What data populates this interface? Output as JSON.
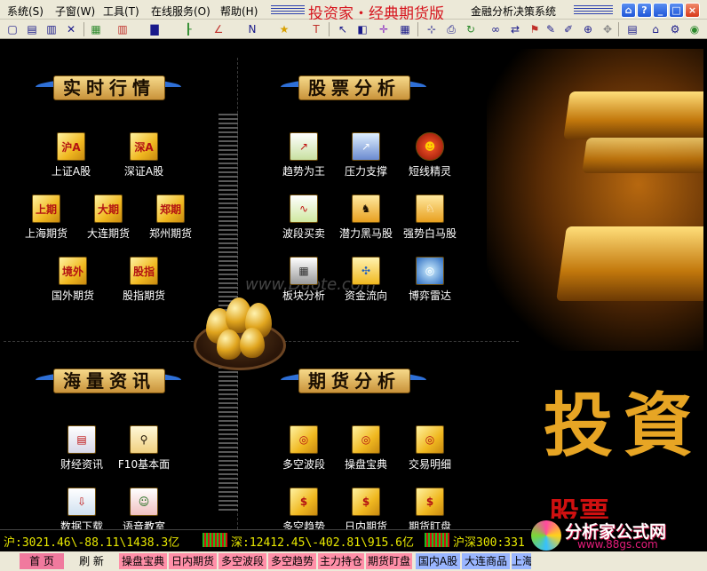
{
  "menu": {
    "system": "系统(S)",
    "subwindow": "子窗(W)",
    "tools": "工具(T)",
    "online": "在线服务(O)",
    "help": "帮助(H)"
  },
  "title": {
    "app_name": "投资家・经典期货版",
    "subtitle": "金融分析决策系统"
  },
  "sections": {
    "realtime": "实时行情",
    "stock_analysis": "股票分析",
    "news": "海量资讯",
    "futures_analysis": "期货分析"
  },
  "realtime_tiles": [
    {
      "icon": "沪A",
      "label": "上证A股"
    },
    {
      "icon": "深A",
      "label": "深证A股"
    },
    {
      "icon": "上期",
      "label": "上海期货"
    },
    {
      "icon": "大期",
      "label": "大连期货"
    },
    {
      "icon": "郑期",
      "label": "郑州期货"
    },
    {
      "icon": "境外",
      "label": "国外期货"
    },
    {
      "icon": "股指",
      "label": "股指期货"
    }
  ],
  "stock_tiles": [
    {
      "icon_name": "trend-chart-icon",
      "label": "趋势为王"
    },
    {
      "icon_name": "pressure-chart-icon",
      "label": "压力支撑"
    },
    {
      "icon_name": "devil-icon",
      "label": "短线精灵"
    },
    {
      "icon_name": "wave-chart-icon",
      "label": "波段买卖"
    },
    {
      "icon_name": "black-horse-icon",
      "label": "潜力黑马股"
    },
    {
      "icon_name": "white-horse-icon",
      "label": "强势白马股"
    },
    {
      "icon_name": "blocks-icon",
      "label": "板块分析"
    },
    {
      "icon_name": "money-flow-icon",
      "label": "资金流向"
    },
    {
      "icon_name": "radar-icon",
      "label": "博弈雷达"
    }
  ],
  "news_tiles": [
    {
      "icon_name": "finance-news-icon",
      "label": "财经资讯"
    },
    {
      "icon_name": "magnifier-icon",
      "label": "F10基本面"
    },
    {
      "icon_name": "download-icon",
      "label": "数据下载"
    },
    {
      "icon_name": "voice-class-icon",
      "label": "语音教室"
    }
  ],
  "futures_tiles": [
    {
      "icon_name": "target-icon",
      "label": "多空波段"
    },
    {
      "icon_name": "target-icon",
      "label": "操盘宝典"
    },
    {
      "icon_name": "target-icon",
      "label": "交易明细"
    },
    {
      "icon_name": "money-bag-icon",
      "label": "多空趋势"
    },
    {
      "icon_name": "money-bag-icon",
      "label": "日内期货"
    },
    {
      "icon_name": "money-bag-icon",
      "label": "期货盯盘"
    }
  ],
  "banner": {
    "big_text": "投資",
    "sub_text": "股票",
    "watermark": "www.Duote.com"
  },
  "ticker": {
    "sh": "沪:3021.46\\-88.11\\1438.3亿",
    "sz": "深:12412.45\\-402.81\\915.6亿",
    "hs300": "沪深300:331"
  },
  "logo": {
    "name": "分析家公式网",
    "url": "www.88gs.com"
  },
  "tabs": [
    "首 页",
    "刷 新",
    "操盘宝典",
    "日内期货",
    "多空波段",
    "多空趋势",
    "主力持仓",
    "期货盯盘",
    "国内A股",
    "大连商品",
    "上海"
  ],
  "colors": {
    "accent_red": "#d6141d",
    "ticker_yellow": "#e8e800",
    "gold": "#e7a524"
  }
}
